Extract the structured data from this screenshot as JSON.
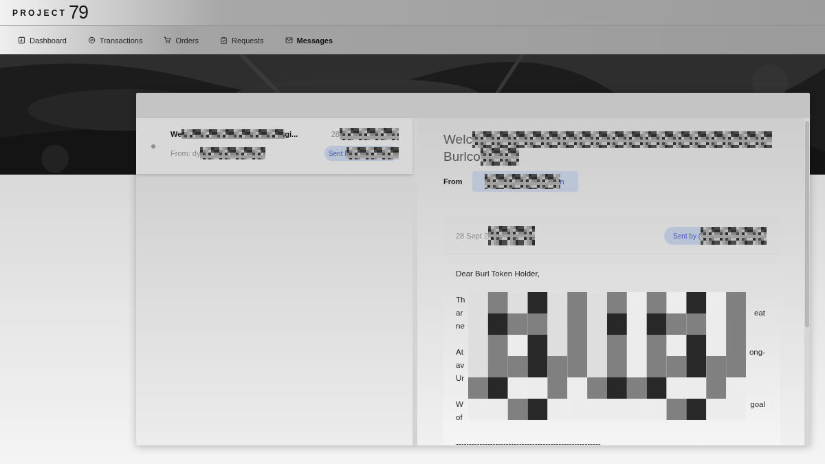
{
  "brand": {
    "name": "PROJECT",
    "number": "79"
  },
  "nav": [
    {
      "label": "Dashboard",
      "selected": false
    },
    {
      "label": "Transactions",
      "selected": false
    },
    {
      "label": "Orders",
      "selected": false
    },
    {
      "label": "Requests",
      "selected": false
    },
    {
      "label": "Messages",
      "selected": true
    }
  ],
  "message_list": [
    {
      "selected": true,
      "unread": true,
      "subject": [
        {
          "kind": "text",
          "text": "We"
        },
        {
          "kind": "redacted"
        },
        {
          "kind": "text",
          "text": "gi..."
        }
      ],
      "from": [
        {
          "kind": "text",
          "text": "From: dy"
        },
        {
          "kind": "redacted"
        }
      ],
      "date": [
        {
          "kind": "text",
          "text": "28"
        },
        {
          "kind": "redacted"
        }
      ],
      "badge": [
        {
          "kind": "text",
          "text": "Sent I"
        },
        {
          "kind": "redacted"
        }
      ]
    }
  ],
  "message": {
    "title_lines": [
      [
        {
          "kind": "text",
          "text": "Welc"
        },
        {
          "kind": "redacted"
        }
      ],
      [
        {
          "kind": "text",
          "text": "Burlco"
        },
        {
          "kind": "redacted"
        }
      ]
    ],
    "from_label": "From",
    "from_value": [
      {
        "kind": "redacted"
      },
      {
        "kind": "text",
        "text": "n"
      }
    ],
    "date": [
      {
        "kind": "text",
        "text": "28 Sept 2"
      },
      {
        "kind": "redacted"
      }
    ],
    "badge": [
      {
        "kind": "text",
        "text": "Sent by ("
      },
      {
        "kind": "redacted"
      }
    ],
    "greeting": "Dear Burl Token Holder,",
    "body_overlay": true,
    "lines": [
      {
        "kind": "blank"
      },
      {
        "kind": "text",
        "left": "Th"
      },
      {
        "kind": "text",
        "left": "ar",
        "right": "eat"
      },
      {
        "kind": "text",
        "left": "ne"
      },
      {
        "kind": "blank"
      },
      {
        "kind": "text",
        "left": "At",
        "right": "ong-"
      },
      {
        "kind": "text",
        "left": "av"
      },
      {
        "kind": "text",
        "left": "Ur"
      },
      {
        "kind": "blank"
      },
      {
        "kind": "text",
        "left": "W",
        "right": "goal"
      },
      {
        "kind": "text",
        "left": "of"
      },
      {
        "kind": "blank"
      },
      {
        "kind": "text",
        "left": "-------------------------------------------------------"
      }
    ]
  }
}
